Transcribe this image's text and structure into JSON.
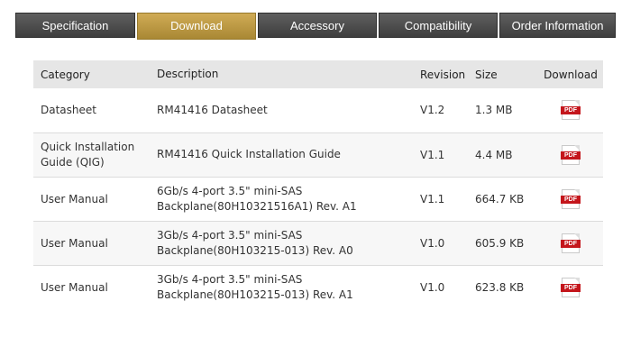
{
  "tabs": [
    {
      "label": "Specification"
    },
    {
      "label": "Download"
    },
    {
      "label": "Accessory"
    },
    {
      "label": "Compatibility"
    },
    {
      "label": "Order Information"
    }
  ],
  "active_tab": "Download",
  "table": {
    "headers": {
      "category": "Category",
      "description": "Description",
      "revision": "Revision",
      "size": "Size",
      "download": "Download"
    },
    "rows": [
      {
        "category": "Datasheet",
        "desc1": "RM41416 Datasheet",
        "desc2": "",
        "revision": "V1.2",
        "size": "1.3 MB",
        "icon": "PDF"
      },
      {
        "category": "Quick Installation Guide (QIG)",
        "desc1": "RM41416 Quick Installation Guide",
        "desc2": "",
        "revision": "V1.1",
        "size": "4.4 MB",
        "icon": "PDF"
      },
      {
        "category": "User Manual",
        "desc1": "6Gb/s 4-port 3.5\" mini-SAS",
        "desc2": "Backplane(80H10321516A1) Rev. A1",
        "revision": "V1.1",
        "size": "664.7 KB",
        "icon": "PDF"
      },
      {
        "category": "User Manual",
        "desc1": "3Gb/s 4-port 3.5\" mini-SAS",
        "desc2": "Backplane(80H103215-013) Rev. A0",
        "revision": "V1.0",
        "size": "605.9 KB",
        "icon": "PDF"
      },
      {
        "category": "User Manual",
        "desc1": "3Gb/s 4-port 3.5\" mini-SAS",
        "desc2": "Backplane(80H103215-013) Rev. A1",
        "revision": "V1.0",
        "size": "623.8 KB",
        "icon": "PDF"
      }
    ]
  },
  "colors": {
    "tab_bg": "#4e4e4e",
    "tab_active_bg": "#bf9b45",
    "header_bg": "#e6e6e6",
    "alt_row_bg": "#f7f7f7",
    "pdf_red": "#c4161c"
  }
}
